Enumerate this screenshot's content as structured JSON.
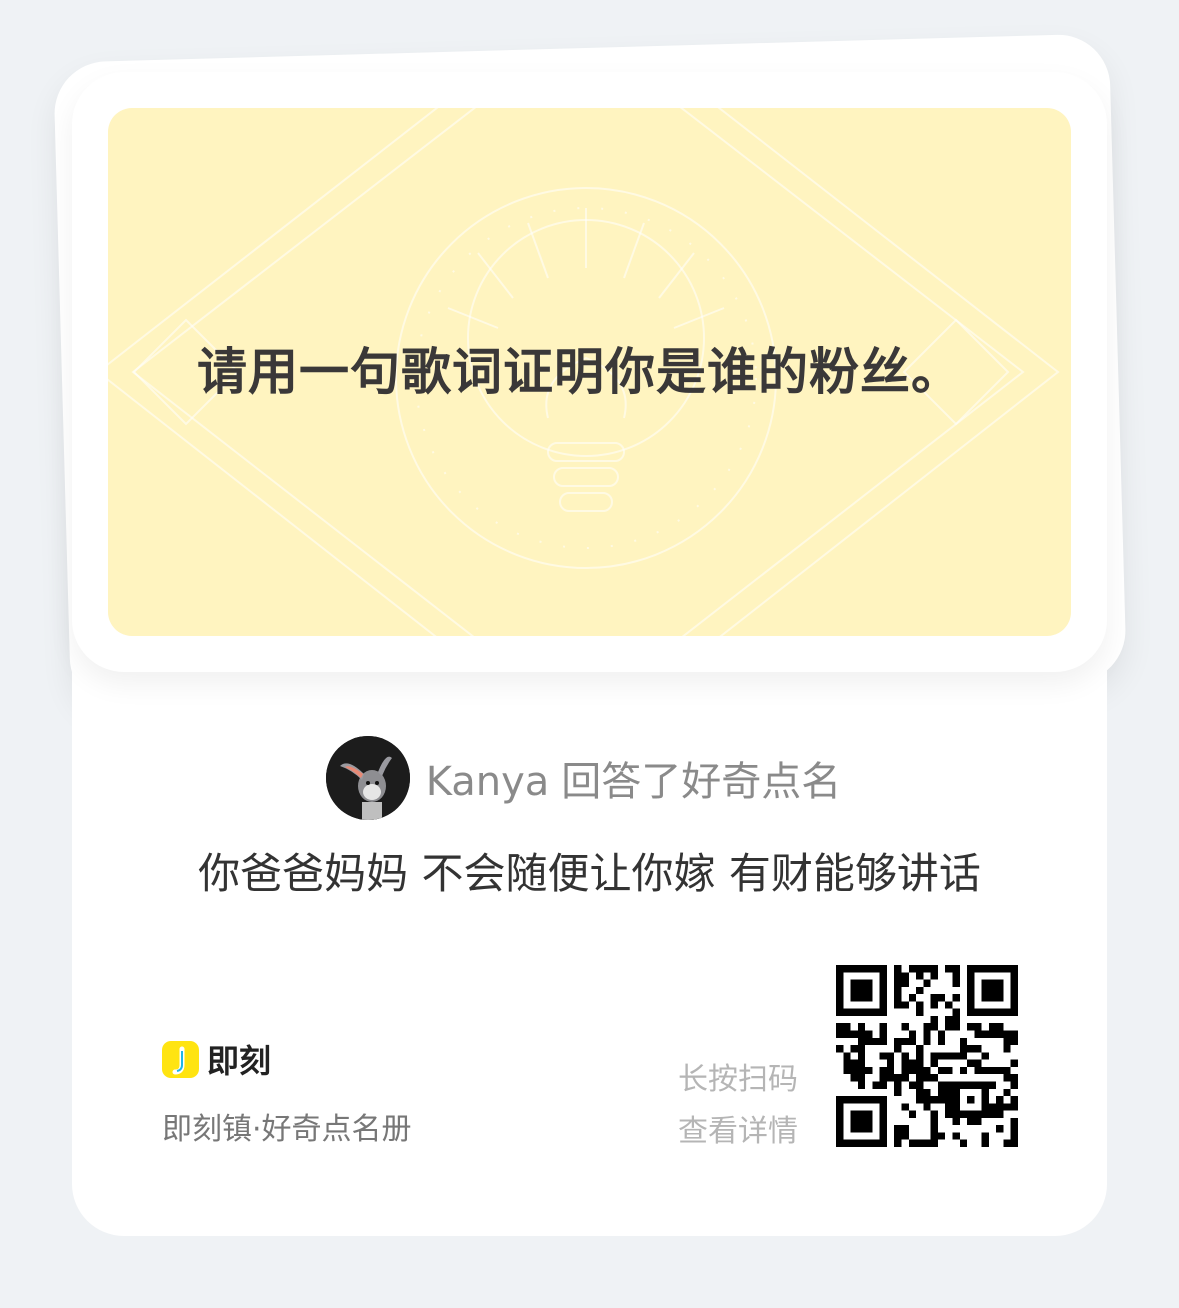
{
  "question": {
    "text": "请用一句歌词证明你是谁的粉丝。"
  },
  "answer": {
    "author": "Kanya",
    "action": "回答了好奇点名",
    "text": "你爸爸妈妈 不会随便让你嫁 有财能够讲话"
  },
  "footer": {
    "brand_name": "即刻",
    "brand_subtitle": "即刻镇·好奇点名册",
    "scan_hint_line1": "长按扫码",
    "scan_hint_line2": "查看详情"
  },
  "icons": {
    "avatar": "rabbit-avatar-icon",
    "logo": "jike-logo-icon",
    "qr": "qr-code"
  },
  "colors": {
    "background": "#eff2f5",
    "card": "#ffffff",
    "question_panel": "#fff4c0",
    "brand_yellow": "#ffe411"
  }
}
